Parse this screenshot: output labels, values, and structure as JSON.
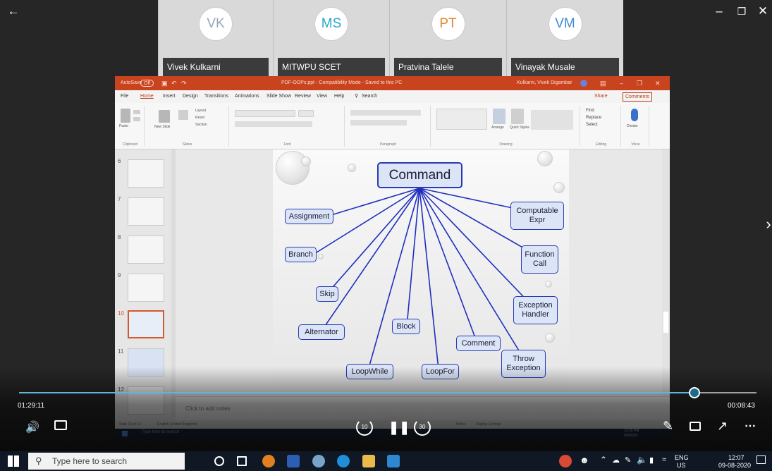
{
  "participants": [
    {
      "initials": "VK",
      "name": "Vivek Kulkarni",
      "color": "#9aa7b7"
    },
    {
      "initials": "MS",
      "name": "MITWPU SCET",
      "color": "#2aa7c9"
    },
    {
      "initials": "PT",
      "name": "Pratvina Talele",
      "color": "#e3862e"
    },
    {
      "initials": "VM",
      "name": "Vinayak Musale",
      "color": "#3b8ad9"
    }
  ],
  "ppt": {
    "titlebar": {
      "autosave": "AutoSave",
      "autosave_state": "Off",
      "doc_title": "PDF-OOPs.ppt - Compatibility Mode - Saved to this PC",
      "user": "Kulkarni, Vivek Digambar"
    },
    "menu": [
      "File",
      "Home",
      "Insert",
      "Design",
      "Transitions",
      "Animations",
      "Slide Show",
      "Review",
      "View",
      "Help"
    ],
    "search": "Search",
    "share": "Share",
    "comments": "Comments",
    "ribbon_groups": [
      "Clipboard",
      "Slides",
      "Font",
      "Paragraph",
      "Drawing",
      "Editing",
      "Voice"
    ],
    "ribbon_labels": {
      "paste": "Paste",
      "new_slide": "New Slide",
      "layout": "Layout",
      "reset": "Reset",
      "section": "Section",
      "arrange": "Arrange",
      "quick_styles": "Quick Styles",
      "find": "Find",
      "replace": "Replace",
      "select": "Select",
      "dictate": "Dictate"
    },
    "thumbs": [
      "6",
      "7",
      "8",
      "9",
      "10",
      "11",
      "12"
    ],
    "active_thumb": "10",
    "notes_placeholder": "Click to add notes",
    "status_left": "Slide 10 of 13",
    "status_lang": "English (United Kingdom)",
    "status_notes": "Notes",
    "status_display": "Display Settings",
    "inner_search": "Type here to search",
    "inner_time": "12:35 PM",
    "inner_date": "9/8/2020"
  },
  "diagram": {
    "root": "Command",
    "nodes": [
      "Assignment",
      "Branch",
      "Skip",
      "Alternator",
      "Block",
      "LoopWhile",
      "LoopFor",
      "Comment",
      "Throw Exception",
      "Exception Handler",
      "Function Call",
      "Computable Expr"
    ]
  },
  "player": {
    "elapsed": "01:29:11",
    "remaining": "00:08:43",
    "progress": 0.92,
    "skip_back": "10",
    "skip_fwd": "30"
  },
  "taskbar": {
    "search_placeholder": "Type here to search",
    "lang": "ENG",
    "region": "US",
    "time": "12:07",
    "date": "09-08-2020"
  }
}
